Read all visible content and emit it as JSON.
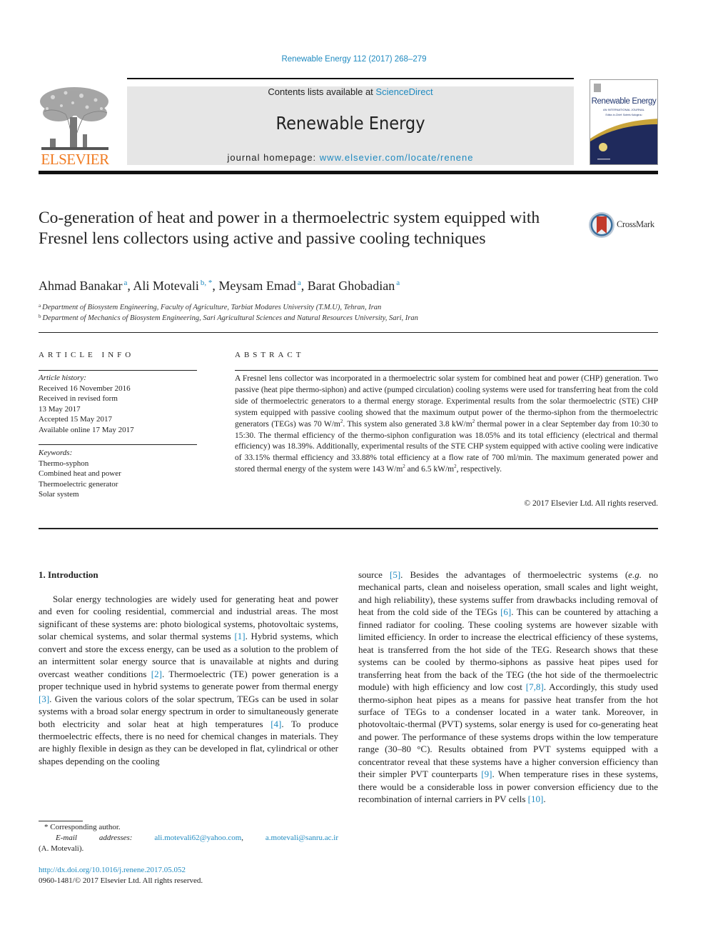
{
  "journal_ref": "Renewable Energy 112 (2017) 268–279",
  "masthead": {
    "contents_prefix": "Contents lists available at ",
    "contents_link": "ScienceDirect",
    "journal_title": "Renewable Energy",
    "homepage_prefix": "journal homepage: ",
    "homepage_link": "www.elsevier.com/locate/renene",
    "publisher": "ELSEVIER",
    "cover": {
      "title": "Renewable Energy",
      "subtitle": "AN INTERNATIONAL JOURNAL",
      "editor_line": "Editor-in-Chief: Soteris Kalogirou"
    }
  },
  "crossmark_label": "CrossMark",
  "article": {
    "title": "Co-generation of heat and power in a thermoelectric system equipped with Fresnel lens collectors using active and passive cooling techniques",
    "authors": [
      {
        "name": "Ahmad Banakar",
        "sup": "a",
        "sep": ", "
      },
      {
        "name": "Ali Motevali",
        "sup": "b, *",
        "sep": ", "
      },
      {
        "name": "Meysam Emad",
        "sup": "a",
        "sep": ", "
      },
      {
        "name": "Barat Ghobadian",
        "sup": "a",
        "sep": ""
      }
    ],
    "affiliations": [
      {
        "sup": "a",
        "text": "Department of Biosystem Engineering, Faculty of Agriculture, Tarbiat Modares University (T.M.U), Tehran, Iran"
      },
      {
        "sup": "b",
        "text": "Department of Mechanics of Biosystem Engineering, Sari Agricultural Sciences and Natural Resources University, Sari, Iran"
      }
    ]
  },
  "article_info": {
    "heading": "ARTICLE INFO",
    "history_label": "Article history:",
    "history": [
      "Received 16 November 2016",
      "Received in revised form",
      "13 May 2017",
      "Accepted 15 May 2017",
      "Available online 17 May 2017"
    ],
    "keywords_label": "Keywords:",
    "keywords": [
      "Thermo-syphon",
      "Combined heat and power",
      "Thermoelectric generator",
      "Solar system"
    ]
  },
  "abstract": {
    "heading": "ABSTRACT",
    "parts": [
      "A Fresnel lens collector was incorporated in a thermoelectric solar system for combined heat and power (CHP) generation. Two passive (heat pipe thermo-siphon) and active (pumped circulation) cooling systems were used for transferring heat from the cold side of thermoelectric generators to a thermal energy storage. Experimental results from the solar thermoelectric (STE) CHP system equipped with passive cooling showed that the maximum output power of the thermo-siphon from the thermoelectric generators (TEGs) was 70 W/m",
      ". This system also generated 3.8 kW/m",
      " thermal power in a clear September day from 10:30 to 15:30. The thermal efficiency of the thermo-siphon configuration was 18.05% and its total efficiency (electrical and thermal efficiency) was 18.39%. Additionally, experimental results of the STE CHP system equipped with active cooling were indicative of 33.15% thermal efficiency and 33.88% total efficiency at a flow rate of 700 ml/min. The maximum generated power and stored thermal energy of the system were 143 W/m",
      " and 6.5 kW/m",
      ", respectively."
    ],
    "sup": "2",
    "copyright": "© 2017 Elsevier Ltd. All rights reserved."
  },
  "intro": {
    "heading": "1.  Introduction",
    "left": [
      "Solar energy technologies are widely used for generating heat and power and even for cooling residential, commercial and industrial areas. The most significant of these systems are: photo biological systems, photovoltaic systems, solar chemical systems, and solar thermal systems ",
      "[1]",
      ". Hybrid systems, which convert and store the excess energy, can be used as a solution to the problem of an intermittent solar energy source that is unavailable at nights and during overcast weather conditions ",
      "[2]",
      ". Thermoelectric (TE) power generation is a proper technique used in hybrid systems to generate power from thermal energy ",
      "[3]",
      ". Given the various colors of the solar spectrum, TEGs can be used in solar systems with a broad solar energy spectrum in order to simultaneously generate both electricity and solar heat at high temperatures ",
      "[4]",
      ". To produce thermoelectric effects, there is no need for chemical changes in materials. They are highly flexible in design as they can be developed in flat, cylindrical or other shapes depending on the cooling"
    ],
    "right": [
      "source ",
      "[5]",
      ". Besides the advantages of thermoelectric systems (",
      "e.g.",
      " no mechanical parts, clean and noiseless operation, small scales and light weight, and high reliability), these systems suffer from drawbacks including removal of heat from the cold side of the TEGs ",
      "[6]",
      ". This can be countered by attaching a finned radiator for cooling. These cooling systems are however sizable with limited efficiency. In order to increase the electrical efficiency of these systems, heat is transferred from the hot side of the TEG. Research shows that these systems can be cooled by thermo-siphons as passive heat pipes used for transferring heat from the back of the TEG (the hot side of the thermoelectric module) with high efficiency and low cost ",
      "[7,8]",
      ". Accordingly, this study used thermo-siphon heat pipes as a means for passive heat transfer from the hot surface of TEGs to a condenser located in a water tank. Moreover, in photovoltaic-thermal (PVT) systems, solar energy is used for co-generating heat and power. The performance of these systems drops within the low temperature range (30–80 °C). Results obtained from PVT systems equipped with a concentrator reveal that these systems have a higher conversion efficiency than their simpler PVT counterparts ",
      "[9]",
      ". When temperature rises in these systems, there would be a considerable loss in power conversion efficiency due to the recombination of internal carriers in PV cells ",
      "[10]",
      "."
    ]
  },
  "footnote": {
    "corresponding": "* Corresponding author.",
    "email_label": "E-mail addresses:",
    "email_label_a": "E-mail",
    "email_label_b": "addresses:",
    "email1": "ali.motevali62@yahoo.com",
    "email1_sep": ",",
    "email2": "a.motevali@sanru.ac.ir",
    "email_owner": "(A. Motevali).",
    "doi": "http://dx.doi.org/10.1016/j.renene.2017.05.052",
    "issn": "0960-1481/© 2017 Elsevier Ltd. All rights reserved."
  },
  "colors": {
    "link": "#1f8ac0",
    "elsevier_orange": "#f07b22",
    "masthead_bg": "#e6e6e6",
    "cover_navy": "#1f2a5c",
    "cover_gold": "#c9a43a"
  }
}
